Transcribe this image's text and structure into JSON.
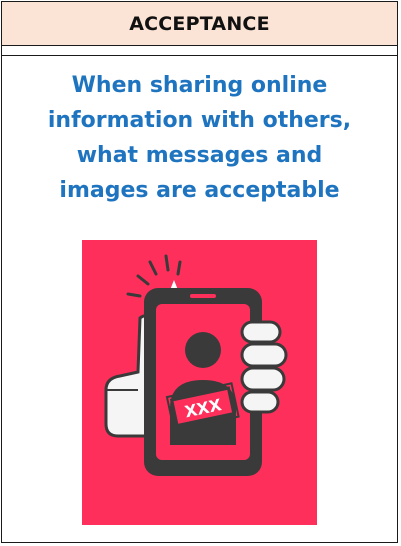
{
  "header": {
    "title": "ACCEPTANCE"
  },
  "question": {
    "lines": [
      "When sharing online",
      "information with others,",
      "what messages and",
      "images are acceptable"
    ]
  },
  "illustration": {
    "icon": "smartphone-hand-explicit-photo-icon",
    "badge_text": "XXX",
    "background_color": "#ff2f5b",
    "outline_color": "#3a3a3a"
  }
}
